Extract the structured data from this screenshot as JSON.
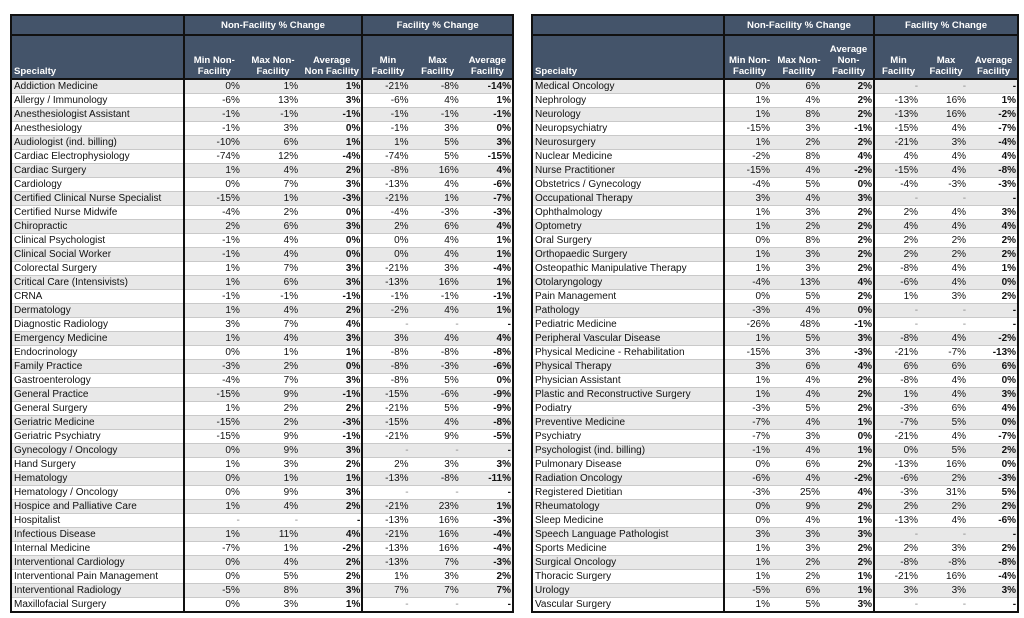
{
  "headers": {
    "group_specialty": "",
    "group_nonfacility": "Non-Facility % Change",
    "group_facility": "Facility % Change",
    "specialty": "Specialty",
    "left": {
      "min_nf": "Min Non-Facility",
      "max_nf": "Max Non-Facility",
      "avg_nf": "Average Non Facility",
      "min_f": "Min Facility",
      "max_f": "Max Facility",
      "avg_f": "Average Facility"
    },
    "right": {
      "min_nf": "Min Non-Facility",
      "max_nf": "Max Non-Facility",
      "avg_nf": "Average Non-Facility",
      "min_f": "Min Facility",
      "max_f": "Max Facility",
      "avg_f": "Average Facility"
    }
  },
  "left_rows": [
    [
      "Addiction Medicine",
      "0%",
      "1%",
      "1%",
      "-21%",
      "-8%",
      "-14%"
    ],
    [
      "Allergy / Immunology",
      "-6%",
      "13%",
      "3%",
      "-6%",
      "4%",
      "1%"
    ],
    [
      "Anesthesiologist Assistant",
      "-1%",
      "-1%",
      "-1%",
      "-1%",
      "-1%",
      "-1%"
    ],
    [
      "Anesthesiology",
      "-1%",
      "3%",
      "0%",
      "-1%",
      "3%",
      "0%"
    ],
    [
      "Audiologist (ind. billing)",
      "-10%",
      "6%",
      "1%",
      "1%",
      "5%",
      "3%"
    ],
    [
      "Cardiac Electrophysiology",
      "-74%",
      "12%",
      "-4%",
      "-74%",
      "5%",
      "-15%"
    ],
    [
      "Cardiac Surgery",
      "1%",
      "4%",
      "2%",
      "-8%",
      "16%",
      "4%"
    ],
    [
      "Cardiology",
      "0%",
      "7%",
      "3%",
      "-13%",
      "4%",
      "-6%"
    ],
    [
      "Certified Clinical Nurse Specialist",
      "-15%",
      "1%",
      "-3%",
      "-21%",
      "1%",
      "-7%"
    ],
    [
      "Certified Nurse Midwife",
      "-4%",
      "2%",
      "0%",
      "-4%",
      "-3%",
      "-3%"
    ],
    [
      "Chiropractic",
      "2%",
      "6%",
      "3%",
      "2%",
      "6%",
      "4%"
    ],
    [
      "Clinical Psychologist",
      "-1%",
      "4%",
      "0%",
      "0%",
      "4%",
      "1%"
    ],
    [
      "Clinical Social Worker",
      "-1%",
      "4%",
      "0%",
      "0%",
      "4%",
      "1%"
    ],
    [
      "Colorectal Surgery",
      "1%",
      "7%",
      "3%",
      "-21%",
      "3%",
      "-4%"
    ],
    [
      "Critical Care (Intensivists)",
      "1%",
      "6%",
      "3%",
      "-13%",
      "16%",
      "1%"
    ],
    [
      "CRNA",
      "-1%",
      "-1%",
      "-1%",
      "-1%",
      "-1%",
      "-1%"
    ],
    [
      "Dermatology",
      "1%",
      "4%",
      "2%",
      "-2%",
      "4%",
      "1%"
    ],
    [
      "Diagnostic Radiology",
      "3%",
      "7%",
      "4%",
      "-",
      "-",
      "-"
    ],
    [
      "Emergency Medicine",
      "1%",
      "4%",
      "3%",
      "3%",
      "4%",
      "4%"
    ],
    [
      "Endocrinology",
      "0%",
      "1%",
      "1%",
      "-8%",
      "-8%",
      "-8%"
    ],
    [
      "Family Practice",
      "-3%",
      "2%",
      "0%",
      "-8%",
      "-3%",
      "-6%"
    ],
    [
      "Gastroenterology",
      "-4%",
      "7%",
      "3%",
      "-8%",
      "5%",
      "0%"
    ],
    [
      "General Practice",
      "-15%",
      "9%",
      "-1%",
      "-15%",
      "-6%",
      "-9%"
    ],
    [
      "General Surgery",
      "1%",
      "2%",
      "2%",
      "-21%",
      "5%",
      "-9%"
    ],
    [
      "Geriatric Medicine",
      "-15%",
      "2%",
      "-3%",
      "-15%",
      "4%",
      "-8%"
    ],
    [
      "Geriatric Psychiatry",
      "-15%",
      "9%",
      "-1%",
      "-21%",
      "9%",
      "-5%"
    ],
    [
      "Gynecology / Oncology",
      "0%",
      "9%",
      "3%",
      "-",
      "-",
      "-"
    ],
    [
      "Hand Surgery",
      "1%",
      "3%",
      "2%",
      "2%",
      "3%",
      "3%"
    ],
    [
      "Hematology",
      "0%",
      "1%",
      "1%",
      "-13%",
      "-8%",
      "-11%"
    ],
    [
      "Hematology / Oncology",
      "0%",
      "9%",
      "3%",
      "-",
      "-",
      "-"
    ],
    [
      "Hospice and Palliative Care",
      "1%",
      "4%",
      "2%",
      "-21%",
      "23%",
      "1%"
    ],
    [
      "Hospitalist",
      "-",
      "-",
      "-",
      "-13%",
      "16%",
      "-3%"
    ],
    [
      "Infectious Disease",
      "1%",
      "11%",
      "4%",
      "-21%",
      "16%",
      "-4%"
    ],
    [
      "Internal Medicine",
      "-7%",
      "1%",
      "-2%",
      "-13%",
      "16%",
      "-4%"
    ],
    [
      "Interventional Cardiology",
      "0%",
      "4%",
      "2%",
      "-13%",
      "7%",
      "-3%"
    ],
    [
      "Interventional Pain Management",
      "0%",
      "5%",
      "2%",
      "1%",
      "3%",
      "2%"
    ],
    [
      "Interventional Radiology",
      "-5%",
      "8%",
      "3%",
      "7%",
      "7%",
      "7%"
    ],
    [
      "Maxillofacial Surgery",
      "0%",
      "3%",
      "1%",
      "-",
      "-",
      "-"
    ]
  ],
  "right_rows": [
    [
      "Medical Oncology",
      "0%",
      "6%",
      "2%",
      "-",
      "-",
      "-"
    ],
    [
      "Nephrology",
      "1%",
      "4%",
      "2%",
      "-13%",
      "16%",
      "1%"
    ],
    [
      "Neurology",
      "1%",
      "8%",
      "2%",
      "-13%",
      "16%",
      "-2%"
    ],
    [
      "Neuropsychiatry",
      "-15%",
      "3%",
      "-1%",
      "-15%",
      "4%",
      "-7%"
    ],
    [
      "Neurosurgery",
      "1%",
      "2%",
      "2%",
      "-21%",
      "3%",
      "-4%"
    ],
    [
      "Nuclear Medicine",
      "-2%",
      "8%",
      "4%",
      "4%",
      "4%",
      "4%"
    ],
    [
      "Nurse Practitioner",
      "-15%",
      "4%",
      "-2%",
      "-15%",
      "4%",
      "-8%"
    ],
    [
      "Obstetrics / Gynecology",
      "-4%",
      "5%",
      "0%",
      "-4%",
      "-3%",
      "-3%"
    ],
    [
      "Occupational Therapy",
      "3%",
      "4%",
      "3%",
      "-",
      "-",
      "-"
    ],
    [
      "Ophthalmology",
      "1%",
      "3%",
      "2%",
      "2%",
      "4%",
      "3%"
    ],
    [
      "Optometry",
      "1%",
      "2%",
      "2%",
      "4%",
      "4%",
      "4%"
    ],
    [
      "Oral Surgery",
      "0%",
      "8%",
      "2%",
      "2%",
      "2%",
      "2%"
    ],
    [
      "Orthopaedic Surgery",
      "1%",
      "3%",
      "2%",
      "2%",
      "2%",
      "2%"
    ],
    [
      "Osteopathic Manipulative Therapy",
      "1%",
      "3%",
      "2%",
      "-8%",
      "4%",
      "1%"
    ],
    [
      "Otolaryngology",
      "-4%",
      "13%",
      "4%",
      "-6%",
      "4%",
      "0%"
    ],
    [
      "Pain Management",
      "0%",
      "5%",
      "2%",
      "1%",
      "3%",
      "2%"
    ],
    [
      "Pathology",
      "-3%",
      "4%",
      "0%",
      "-",
      "-",
      "-"
    ],
    [
      "Pediatric Medicine",
      "-26%",
      "48%",
      "-1%",
      "-",
      "-",
      "-"
    ],
    [
      "Peripheral Vascular Disease",
      "1%",
      "5%",
      "3%",
      "-8%",
      "4%",
      "-2%"
    ],
    [
      "Physical Medicine - Rehabilitation",
      "-15%",
      "3%",
      "-3%",
      "-21%",
      "-7%",
      "-13%"
    ],
    [
      "Physical Therapy",
      "3%",
      "6%",
      "4%",
      "6%",
      "6%",
      "6%"
    ],
    [
      "Physician Assistant",
      "1%",
      "4%",
      "2%",
      "-8%",
      "4%",
      "0%"
    ],
    [
      "Plastic and Reconstructive Surgery",
      "1%",
      "4%",
      "2%",
      "1%",
      "4%",
      "3%"
    ],
    [
      "Podiatry",
      "-3%",
      "5%",
      "2%",
      "-3%",
      "6%",
      "4%"
    ],
    [
      "Preventive Medicine",
      "-7%",
      "4%",
      "1%",
      "-7%",
      "5%",
      "0%"
    ],
    [
      "Psychiatry",
      "-7%",
      "3%",
      "0%",
      "-21%",
      "4%",
      "-7%"
    ],
    [
      "Psychologist (ind. billing)",
      "-1%",
      "4%",
      "1%",
      "0%",
      "5%",
      "2%"
    ],
    [
      "Pulmonary Disease",
      "0%",
      "6%",
      "2%",
      "-13%",
      "16%",
      "0%"
    ],
    [
      "Radiation Oncology",
      "-6%",
      "4%",
      "-2%",
      "-6%",
      "2%",
      "-3%"
    ],
    [
      "Registered Dietitian",
      "-3%",
      "25%",
      "4%",
      "-3%",
      "31%",
      "5%"
    ],
    [
      "Rheumatology",
      "0%",
      "9%",
      "2%",
      "2%",
      "2%",
      "2%"
    ],
    [
      "Sleep Medicine",
      "0%",
      "4%",
      "1%",
      "-13%",
      "4%",
      "-6%"
    ],
    [
      "Speech Language Pathologist",
      "3%",
      "3%",
      "3%",
      "-",
      "-",
      "-"
    ],
    [
      "Sports Medicine",
      "1%",
      "3%",
      "2%",
      "2%",
      "3%",
      "2%"
    ],
    [
      "Surgical Oncology",
      "1%",
      "2%",
      "2%",
      "-8%",
      "-8%",
      "-8%"
    ],
    [
      "Thoracic Surgery",
      "1%",
      "2%",
      "1%",
      "-21%",
      "16%",
      "-4%"
    ],
    [
      "Urology",
      "-5%",
      "6%",
      "1%",
      "3%",
      "3%",
      "3%"
    ],
    [
      "Vascular Surgery",
      "1%",
      "5%",
      "3%",
      "-",
      "-",
      "-"
    ]
  ]
}
